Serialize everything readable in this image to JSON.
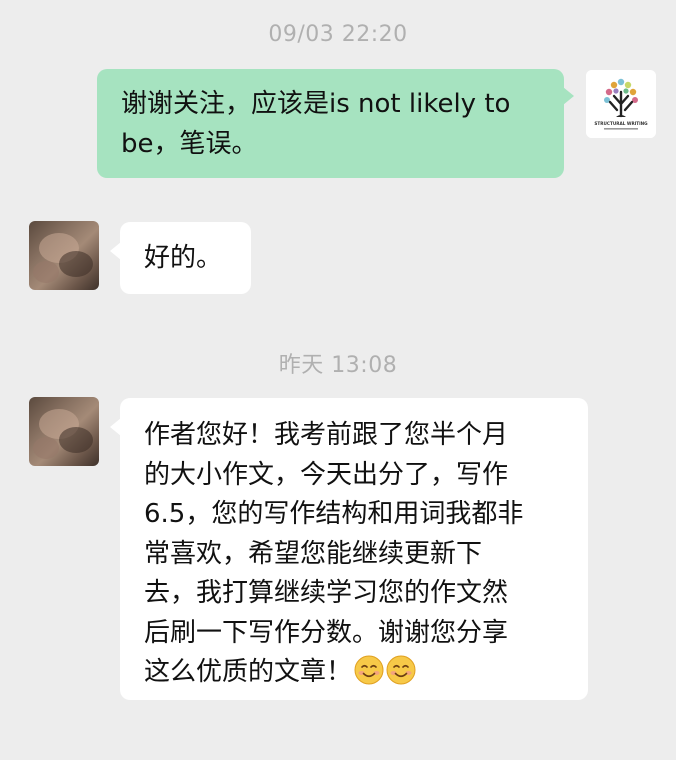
{
  "chat": {
    "timestamp_1": "09/03 22:20",
    "timestamp_2": "昨天 13:08",
    "messages": [
      {
        "sender": "self",
        "lines": [
          "谢谢关注，应该是is not likely to",
          "be，笔误。"
        ]
      },
      {
        "sender": "other",
        "lines": [
          "好的。"
        ]
      },
      {
        "sender": "other",
        "lines": [
          "作者您好！我考前跟了您半个月",
          "的大小作文，今天出分了，写作",
          "6.5，您的写作结构和用词我都非",
          "常喜欢，希望您能继续更新下",
          "去，我打算继续学习您的作文然",
          "后刷一下写作分数。谢谢您分享",
          "这么优质的文章！"
        ],
        "emoji": [
          "smiling-face",
          "smiling-face"
        ]
      }
    ],
    "self_avatar": {
      "logo_text": "STRUCTURAL WRITING"
    }
  }
}
